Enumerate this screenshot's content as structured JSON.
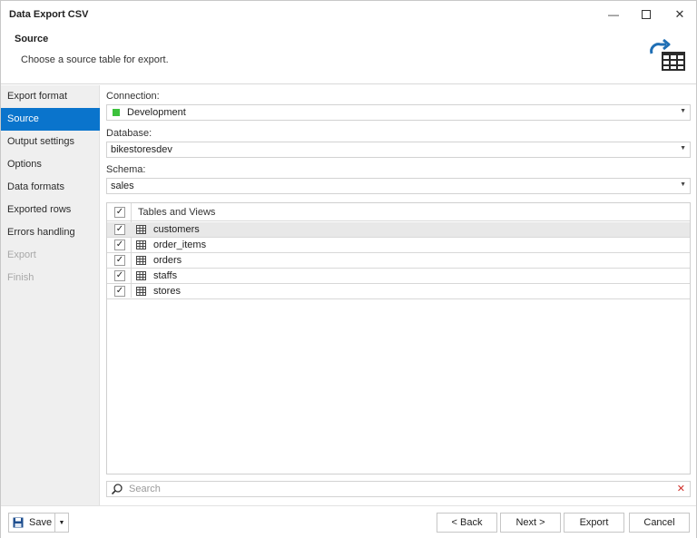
{
  "window": {
    "title": "Data Export CSV"
  },
  "header": {
    "title": "Source",
    "subtitle": "Choose a source table for export."
  },
  "sidebar": {
    "items": [
      {
        "label": "Export format",
        "state": "normal"
      },
      {
        "label": "Source",
        "state": "active"
      },
      {
        "label": "Output settings",
        "state": "normal"
      },
      {
        "label": "Options",
        "state": "normal"
      },
      {
        "label": "Data formats",
        "state": "normal"
      },
      {
        "label": "Exported rows",
        "state": "normal"
      },
      {
        "label": "Errors handling",
        "state": "normal"
      },
      {
        "label": "Export",
        "state": "disabled"
      },
      {
        "label": "Finish",
        "state": "disabled"
      }
    ]
  },
  "form": {
    "connection_label": "Connection:",
    "connection_value": "Development",
    "connection_color": "#3cc13c",
    "database_label": "Database:",
    "database_value": "bikestoresdev",
    "schema_label": "Schema:",
    "schema_value": "sales"
  },
  "grid": {
    "header": "Tables and Views",
    "header_checked": true,
    "rows": [
      {
        "name": "customers",
        "checked": true,
        "selected": true
      },
      {
        "name": "order_items",
        "checked": true,
        "selected": false
      },
      {
        "name": "orders",
        "checked": true,
        "selected": false
      },
      {
        "name": "staffs",
        "checked": true,
        "selected": false
      },
      {
        "name": "stores",
        "checked": true,
        "selected": false
      }
    ]
  },
  "search": {
    "placeholder": "Search"
  },
  "footer": {
    "save_label": "Save",
    "back_label": "< Back",
    "next_label": "Next >",
    "export_label": "Export",
    "cancel_label": "Cancel"
  },
  "colors": {
    "accent": "#0a74cc"
  }
}
